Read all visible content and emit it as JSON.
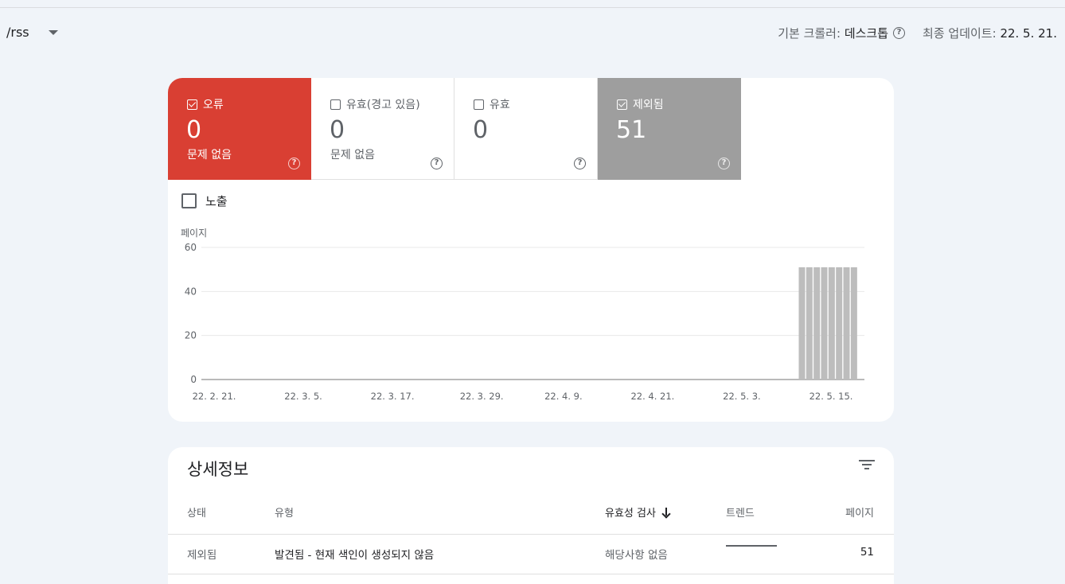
{
  "property": {
    "path": "/rss"
  },
  "meta": {
    "crawler_label": "기본 크롤러:",
    "crawler_value": "데스크톱",
    "updated_label": "최종 업데이트:",
    "updated_value": "22. 5. 21."
  },
  "tiles": [
    {
      "label": "오류",
      "count": "0",
      "sub": "문제 없음",
      "checked": true,
      "color": "#d93f33"
    },
    {
      "label": "유효(경고 있음)",
      "count": "0",
      "sub": "문제 없음",
      "checked": false
    },
    {
      "label": "유효",
      "count": "0",
      "sub": "",
      "checked": false
    },
    {
      "label": "제외됨",
      "count": "51",
      "sub": "",
      "checked": true,
      "color": "#9e9e9e"
    }
  ],
  "impressions": {
    "label": "노출",
    "checked": false
  },
  "chart_data": {
    "type": "bar",
    "ylabel": "페이지",
    "ylim": [
      0,
      60
    ],
    "yticks": [
      0,
      20,
      40,
      60
    ],
    "x_tick_labels": [
      "22. 2. 21.",
      "22. 3. 5.",
      "22. 3. 17.",
      "22. 3. 29.",
      "22. 4. 9.",
      "22. 4. 21.",
      "22. 5. 3.",
      "22. 5. 15."
    ],
    "x_tick_days": [
      0,
      12,
      24,
      36,
      47,
      59,
      71,
      83
    ],
    "grid": true,
    "series": [
      {
        "color": "#bdbdbd",
        "bar_days": [
          84,
          85,
          86,
          87,
          88,
          89,
          90,
          91
        ],
        "values": [
          51,
          51,
          51,
          51,
          51,
          51,
          51,
          51
        ]
      }
    ]
  },
  "details": {
    "title": "상세정보",
    "columns": {
      "status": "상태",
      "type": "유형",
      "validation": "유효성 검사",
      "trend": "트렌드",
      "pages": "페이지"
    },
    "rows": [
      {
        "status": "제외됨",
        "type": "발견됨 - 현재 색인이 생성되지 않음",
        "validation": "해당사항 없음",
        "pages": "51"
      }
    ]
  }
}
